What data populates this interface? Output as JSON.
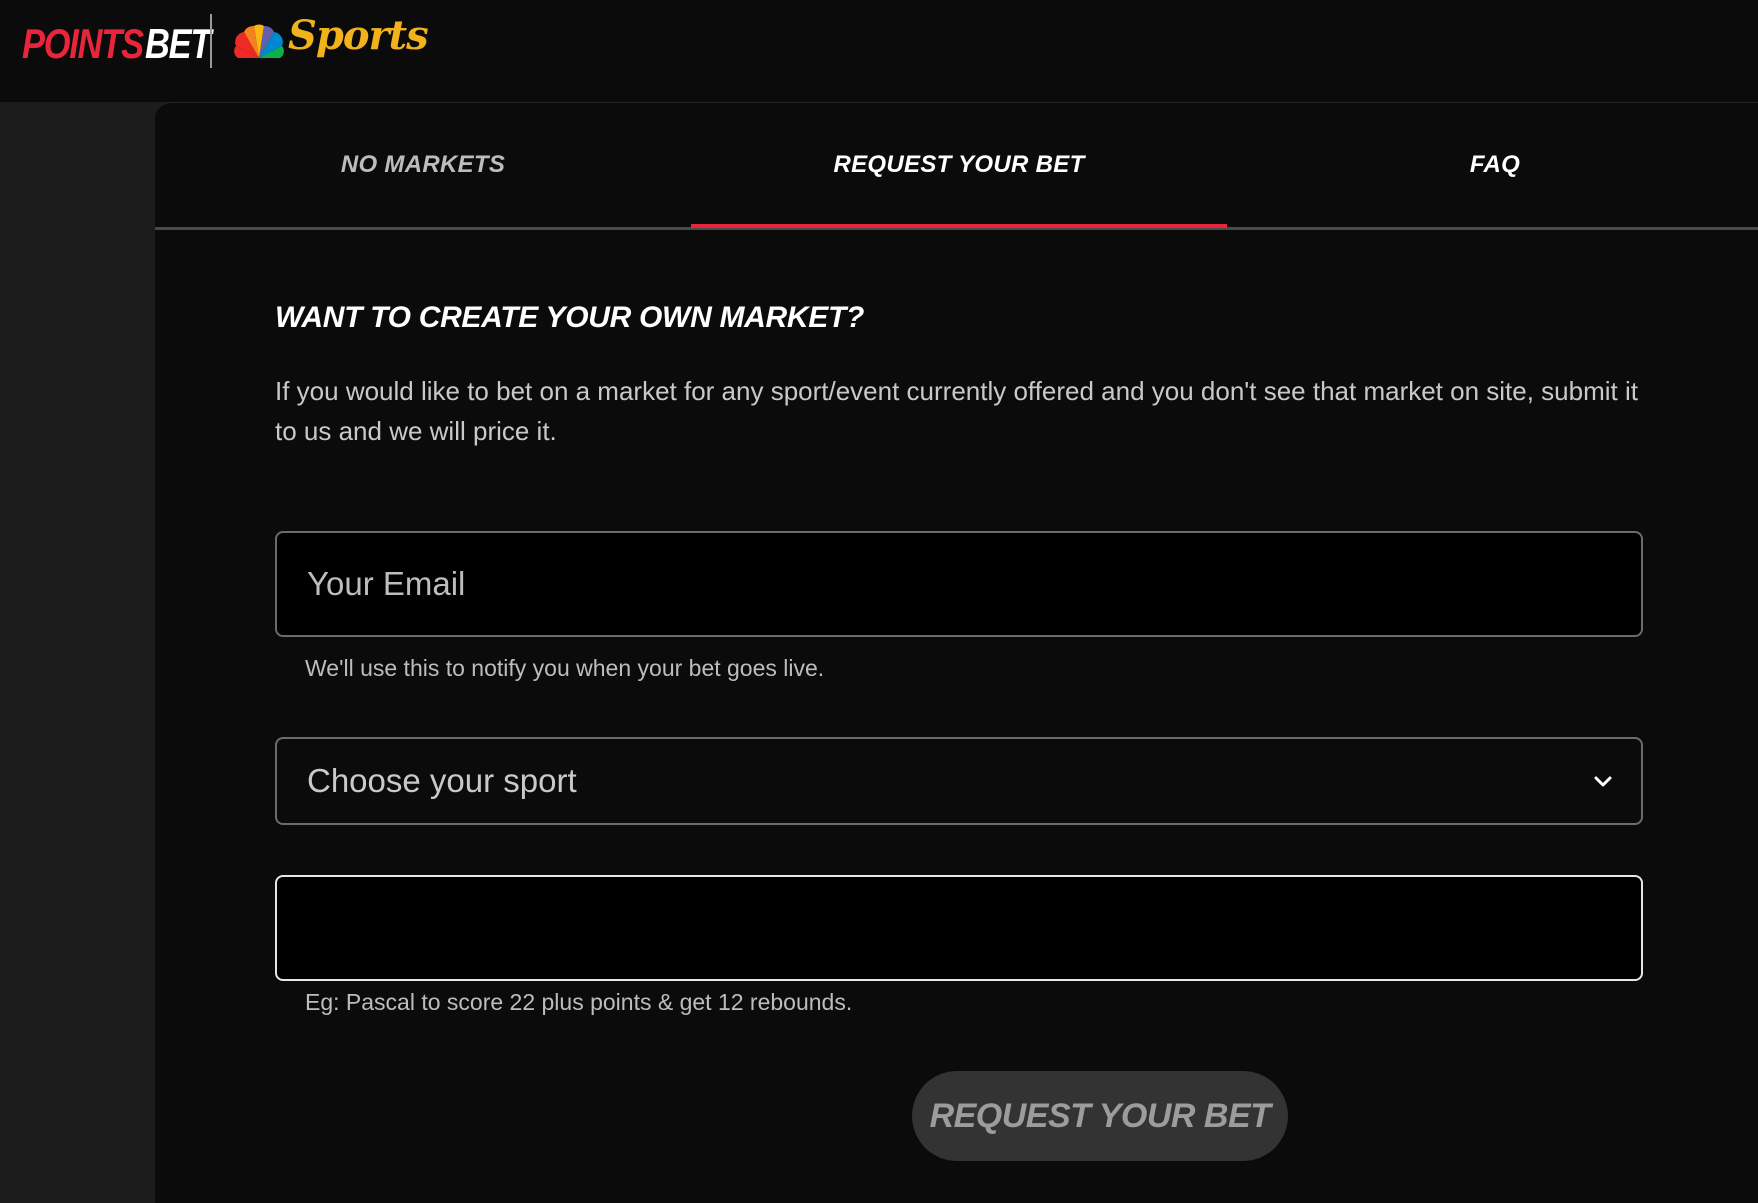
{
  "brand": {
    "logo_points": "POINTS",
    "logo_bet": "BET",
    "partner_word": "Sports",
    "colors": {
      "accent_red": "#e8253b",
      "gold": "#f2b21b"
    }
  },
  "tabs": [
    {
      "label": "NO MARKETS",
      "active": false
    },
    {
      "label": "REQUEST YOUR BET",
      "active": true
    },
    {
      "label": "FAQ",
      "active": false
    }
  ],
  "form": {
    "heading": "WANT TO CREATE YOUR OWN MARKET?",
    "intro": "If you would like to bet on a market for any sport/event currently offered and you don't see that market on site, submit it to us and we will price it.",
    "email_placeholder": "Your Email",
    "email_hint": "We'll use this to notify you when your bet goes live.",
    "sport_select_value": "Choose your sport",
    "sport_select_icon": "chevron-down-icon",
    "bet_value": "",
    "bet_hint": "Eg: Pascal to score 22 plus points & get 12 rebounds.",
    "submit_label": "REQUEST YOUR BET"
  }
}
